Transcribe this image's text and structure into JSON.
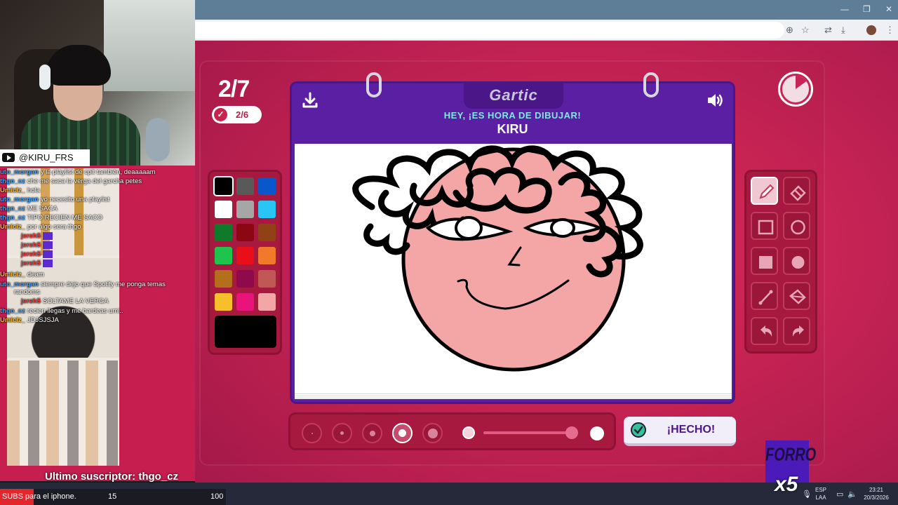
{
  "game": {
    "round": "2/7",
    "players_done": "2/6",
    "logo": "Gartic",
    "instruction": "HEY, ¡ES HORA DE DIBUJAR!",
    "prompt": "KIRU",
    "done_label": "¡HECHO!",
    "timer_remaining_fraction": 0.85
  },
  "palette": {
    "colors": [
      "#000000",
      "#595959",
      "#0a57cc",
      "#ffffff",
      "#a6a6a6",
      "#29c6f5",
      "#107a2b",
      "#8b0711",
      "#914116",
      "#1ec44b",
      "#e80f18",
      "#f0792a",
      "#b36f1c",
      "#8f0a4a",
      "#c05856",
      "#f5c02a",
      "#e9137c",
      "#f4a5a6"
    ],
    "selected": "#000000",
    "current": "#000000"
  },
  "tools": [
    "pencil-icon",
    "eraser-icon",
    "rect-outline-icon",
    "ellipse-outline-icon",
    "rect-filled-icon",
    "ellipse-filled-icon",
    "line-icon",
    "fill-bucket-icon",
    "undo-icon",
    "redo-icon"
  ],
  "brush": {
    "sizes": 5,
    "selected_size": 4,
    "opacity_percent": 100
  },
  "stream": {
    "handle": "@KIRU_FRS",
    "last_sub_label": "Ultimo suscriptor: thgo_cz",
    "goal_text": "SUBS para el iphone.",
    "goal_current": "15",
    "goal_target": "100",
    "forro_label": "FORRO",
    "forro_multiplier": "x5",
    "chat": [
      {
        "user": "uto_morgan",
        "msg": "y la playlist de cplt también, deaaaaam",
        "color": "#3da2ff"
      },
      {
        "user": "thgo_cz",
        "msg": "che me saca la verga del garcha petes",
        "color": "#3da2ff"
      },
      {
        "user": "Umiclz_",
        "msg": "hola",
        "color": "#f4b830"
      },
      {
        "user": "uto_morgan",
        "msg": "yo necesito una playlist",
        "color": "#3da2ff"
      },
      {
        "user": "thgo_cz",
        "msg": "ME SACA",
        "color": "#3da2ff"
      },
      {
        "user": "thgo_cz",
        "msg": "TIPO RECIEN ME SACO",
        "color": "#3da2ff"
      },
      {
        "user": "Umiclz_",
        "msg": "por algo sera thgo",
        "color": "#f4b830"
      },
      {
        "user": "jereh5",
        "msg": "",
        "color": "#ff4040"
      },
      {
        "user": "jereh5",
        "msg": "",
        "color": "#ff4040"
      },
      {
        "user": "jereh5",
        "msg": "",
        "color": "#ff4040"
      },
      {
        "user": "jereh5",
        "msg": "",
        "color": "#ff4040"
      },
      {
        "user": "Umiclz_",
        "msg": "deam",
        "color": "#f4b830"
      },
      {
        "user": "uto_morgan",
        "msg": "siempre dejo que Spotify me ponga temas",
        "color": "#3da2ff"
      },
      {
        "user": "",
        "msg": "randoms",
        "color": "#ffffff"
      },
      {
        "user": "jereh5",
        "msg": "SOLTAME LA VERGA",
        "color": "#ff4040"
      },
      {
        "user": "thgo_cz",
        "msg": "recien llegas y me bardeas umi..",
        "color": "#3da2ff"
      },
      {
        "user": "Umiclz_",
        "msg": "JDJSJSJA",
        "color": "#f4b830"
      }
    ]
  },
  "taskbar": {
    "lang_top": "ESP",
    "lang_bottom": "LAA",
    "time": "23:21",
    "date": "20/3/2026"
  }
}
